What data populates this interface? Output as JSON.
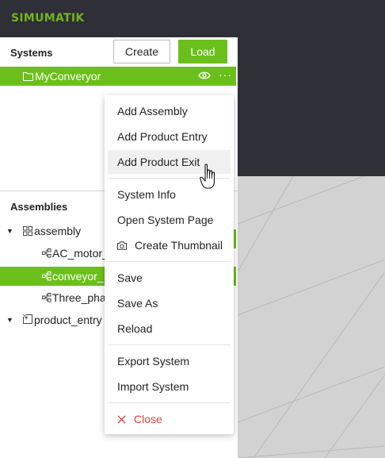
{
  "brand": {
    "logo_text": "SIMUMATIK",
    "accent": "#6bbf1b"
  },
  "systems": {
    "title": "Systems",
    "create_label": "Create",
    "load_label": "Load",
    "selected_system": "MyConveryor"
  },
  "assemblies": {
    "title": "Assemblies",
    "items": [
      {
        "label": "assembly",
        "icon": "assembly-icon",
        "expanded": true
      },
      {
        "label": "AC_motor_",
        "icon": "component-icon"
      },
      {
        "label": "conveyor_",
        "icon": "component-icon",
        "selected": true
      },
      {
        "label": "Three_pha",
        "icon": "component-icon"
      },
      {
        "label": "product_entry",
        "icon": "product-entry-icon",
        "expanded": true
      }
    ]
  },
  "context_menu": {
    "items": [
      {
        "label": "Add Assembly"
      },
      {
        "label": "Add Product Entry"
      },
      {
        "label": "Add Product Exit",
        "hovered": true
      },
      {
        "label": "System Info"
      },
      {
        "label": "Open System Page"
      },
      {
        "label": "Create Thumbnail",
        "icon": "camera-icon"
      },
      {
        "label": "Save"
      },
      {
        "label": "Save As"
      },
      {
        "label": "Reload"
      },
      {
        "label": "Export System"
      },
      {
        "label": "Import System"
      },
      {
        "label": "Close",
        "icon": "close-icon",
        "color": "#e0443c"
      }
    ]
  }
}
